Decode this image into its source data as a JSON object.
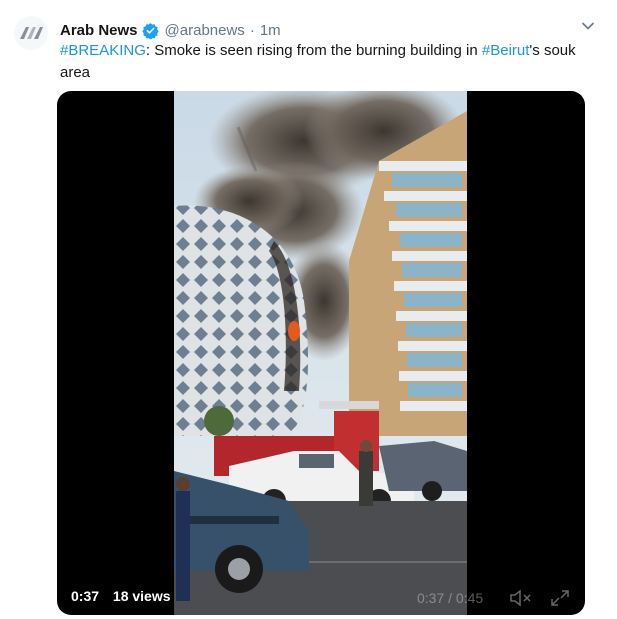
{
  "tweet": {
    "author_name": "Arab News",
    "handle": "@arabnews",
    "separator": "·",
    "time_ago": "1m",
    "text_hashtag_1": "#BREAKING",
    "text_part_1": ": Smoke is seen rising from the burning building in ",
    "text_hashtag_2": "#Beirut",
    "text_part_2": "'s souk area"
  },
  "video": {
    "elapsed": "0:37",
    "views": "18 views",
    "faint_progress": "0:37 / 0:45"
  },
  "icons": {
    "avatar": "arab-news-logo",
    "verified": "verified-badge-icon",
    "caret": "chevron-down-icon",
    "volume": "speaker-muted-icon",
    "fullscreen": "expand-icon"
  },
  "colors": {
    "link": "#1b95e0",
    "verified": "#1da1f2",
    "secondary_text": "#657786"
  }
}
